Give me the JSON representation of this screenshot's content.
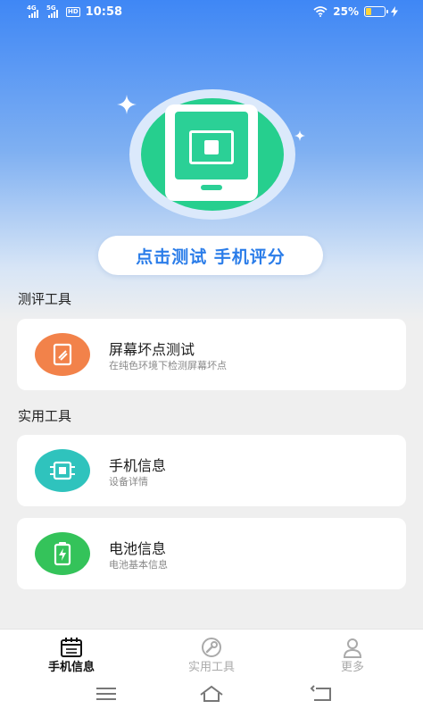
{
  "status_bar": {
    "signal1_tag": "4G",
    "signal2_tag": "5G",
    "hd_badge": "HD",
    "time": "10:58",
    "battery_text": "25%",
    "battery_level": 0.25,
    "battery_color": "#ffd43a"
  },
  "hero": {
    "cta_label": "点击测试 手机评分",
    "accent_color": "#26cf8e"
  },
  "sections": [
    {
      "title": "测评工具",
      "items": [
        {
          "title": "屏幕坏点测试",
          "subtitle": "在纯色环境下检测屏幕坏点",
          "icon": "screen-test-icon",
          "color": "#f2824a"
        }
      ]
    },
    {
      "title": "实用工具",
      "items": [
        {
          "title": "手机信息",
          "subtitle": "设备详情",
          "icon": "chip-icon",
          "color": "#2fc3bd"
        },
        {
          "title": "电池信息",
          "subtitle": "电池基本信息",
          "icon": "battery-icon",
          "color": "#34c35a"
        }
      ]
    }
  ],
  "bottom_nav": [
    {
      "label": "手机信息",
      "icon": "calendar-icon",
      "active": true
    },
    {
      "label": "实用工具",
      "icon": "wrench-icon",
      "active": false
    },
    {
      "label": "更多",
      "icon": "user-icon",
      "active": false
    }
  ]
}
